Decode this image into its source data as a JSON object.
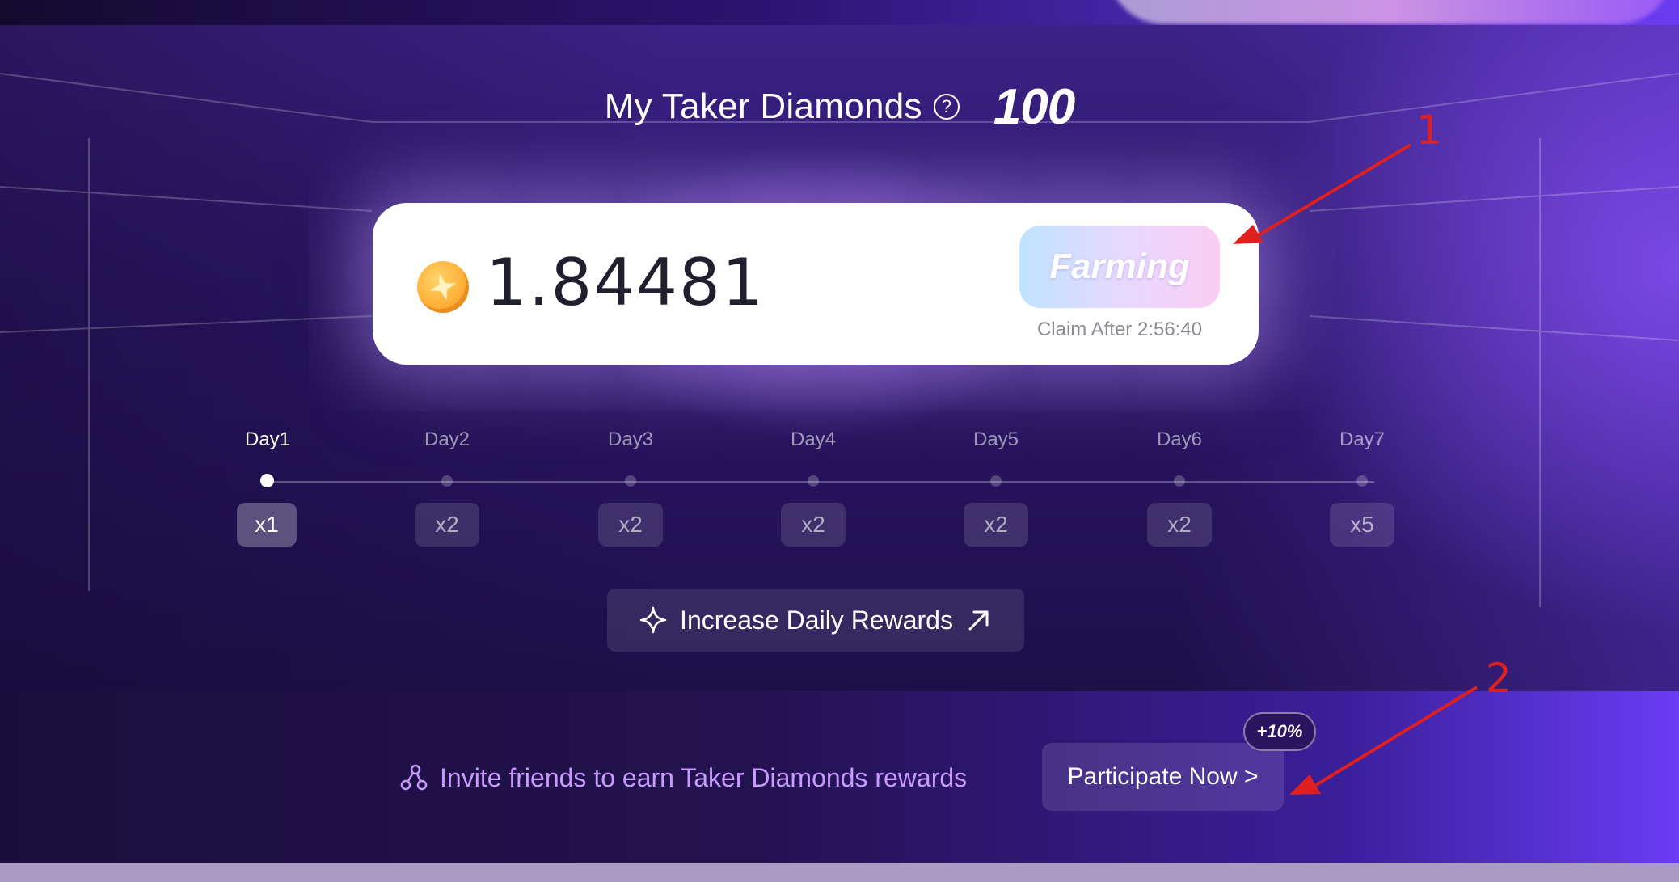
{
  "header": {
    "title": "My Taker Diamonds",
    "help_icon": "question-circle-icon",
    "diamond_count": "100"
  },
  "balance_card": {
    "coin_icon": "coin-star-icon",
    "balance": "1.84481",
    "farming_label": "Farming",
    "claim_text": "Claim After 2:56:40"
  },
  "streak": {
    "days": [
      {
        "label": "Day1",
        "multiplier": "x1",
        "active": true
      },
      {
        "label": "Day2",
        "multiplier": "x2",
        "active": false
      },
      {
        "label": "Day3",
        "multiplier": "x2",
        "active": false
      },
      {
        "label": "Day4",
        "multiplier": "x2",
        "active": false
      },
      {
        "label": "Day5",
        "multiplier": "x2",
        "active": false
      },
      {
        "label": "Day6",
        "multiplier": "x2",
        "active": false
      },
      {
        "label": "Day7",
        "multiplier": "x5",
        "active": false
      }
    ]
  },
  "increase_rewards": {
    "label": "Increase Daily Rewards",
    "left_icon": "sparkle-icon",
    "right_icon": "arrow-up-right-icon"
  },
  "invite": {
    "icon": "share-nodes-icon",
    "text": "Invite friends to earn Taker Diamonds rewards",
    "button_label": "Participate Now >",
    "bonus_badge": "+10%"
  },
  "annotations": {
    "label_1": "1",
    "label_2": "2",
    "color": "#e0201e"
  },
  "colors": {
    "accent_purple": "#c99bff",
    "card_bg": "#ffffff",
    "balance_text": "#1f1f2e"
  }
}
